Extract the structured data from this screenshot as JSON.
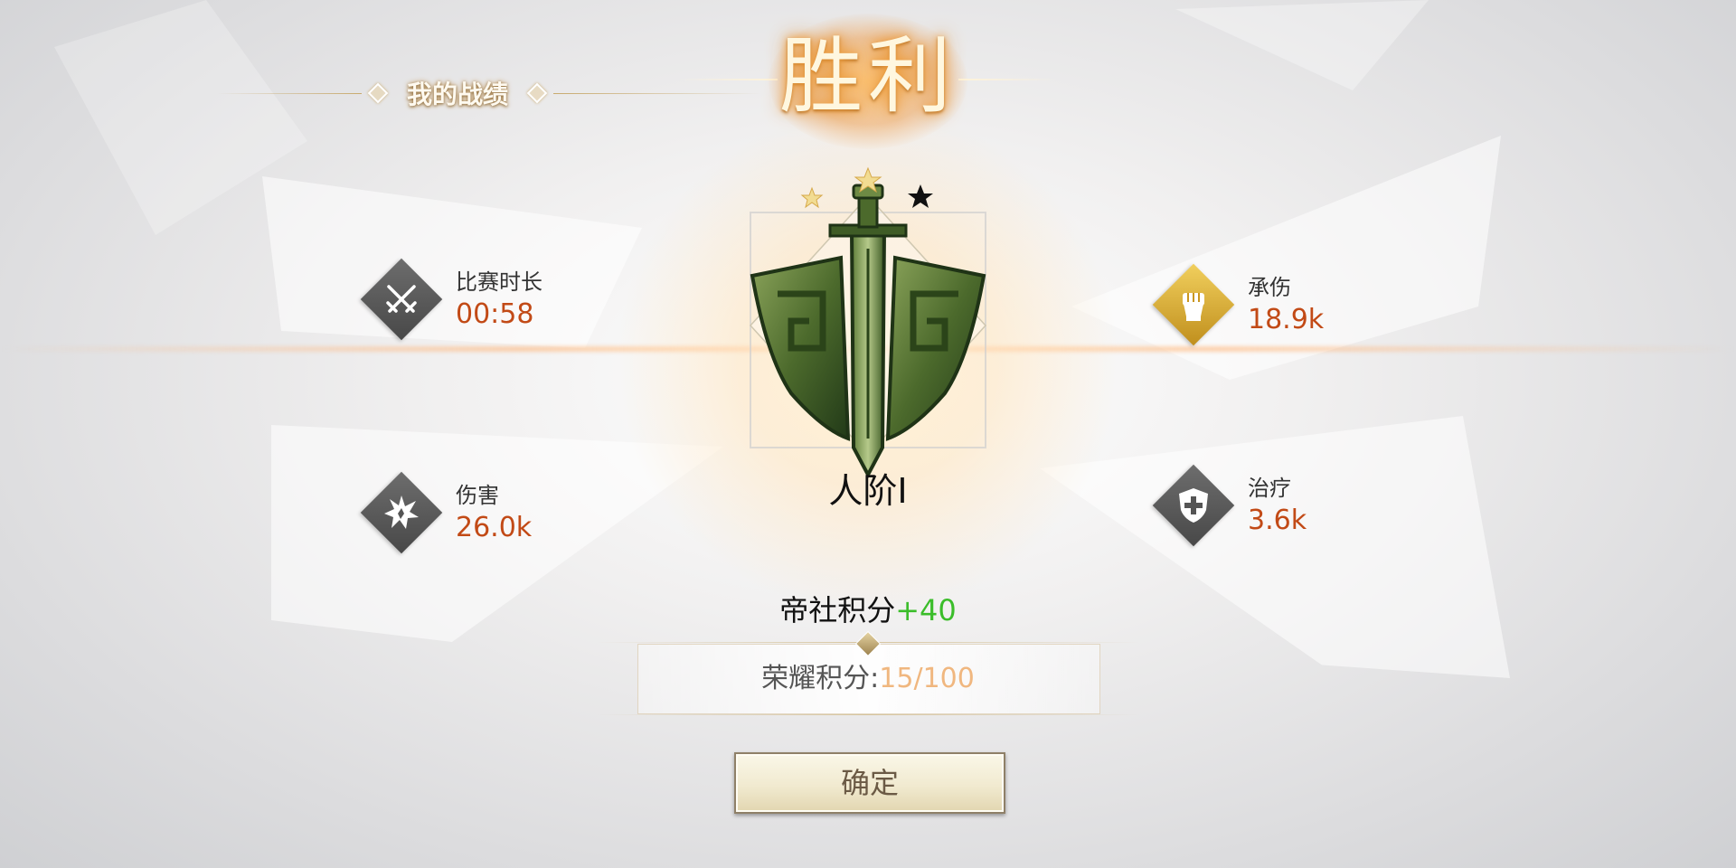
{
  "section": {
    "title": "我的战绩"
  },
  "result": {
    "title": "胜利"
  },
  "stats": {
    "duration": {
      "label": "比赛时长",
      "value": "00:58",
      "icon": "crossed-swords-icon"
    },
    "damage": {
      "label": "伤害",
      "value": "26.0k",
      "icon": "explosion-icon"
    },
    "damage_taken": {
      "label": "承伤",
      "value": "18.9k",
      "icon": "fist-icon"
    },
    "healing": {
      "label": "治疗",
      "value": "3.6k",
      "icon": "shield-cross-icon"
    }
  },
  "rank": {
    "name": "人阶I",
    "stars_filled": 2,
    "stars_total": 3
  },
  "points": {
    "label": "帝社积分",
    "delta": "+40"
  },
  "honor": {
    "label": "荣耀积分:",
    "value": "15/100"
  },
  "confirm": {
    "label": "确定"
  },
  "colors": {
    "stat_value": "#c24a16",
    "points_plus": "#3bbd2a",
    "honor_value": "#f0b77f",
    "icon_gold": "#d7a93a",
    "icon_gray": "#555555"
  }
}
